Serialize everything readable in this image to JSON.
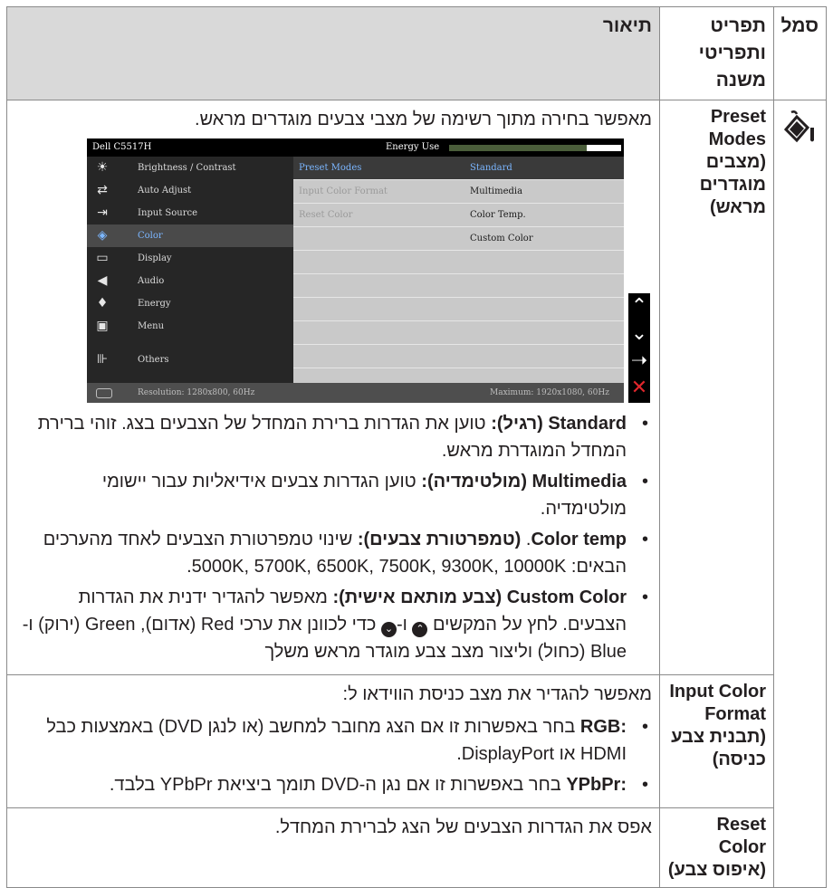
{
  "header": {
    "symbol": "סמל",
    "submenu": "תפריט ותפריטי משנה",
    "description": "תיאור"
  },
  "rows": [
    {
      "icon": "color-icon",
      "name": "Preset Modes (מצבים מוגדרים מראש)",
      "intro": "מאפשר בחירה מתוך רשימה של מצבי צבעים מוגדרים מראש."
    },
    {
      "name": "Input Color Format (תבנית צבע כניסה)",
      "intro": "מאפשר להגדיר את מצב כניסת הווידאו ל:"
    },
    {
      "name": "Reset Color (איפוס צבע)",
      "intro": "אפס את הגדרות הצבעים של הצג לברירת המחדל."
    }
  ],
  "osd": {
    "model": "Dell C5517H",
    "energy_label": "Energy Use",
    "energy_level": 0.8,
    "menu": [
      {
        "icon": "brightness-icon",
        "label": "Brightness / Contrast"
      },
      {
        "icon": "auto-adjust-icon",
        "label": "Auto Adjust"
      },
      {
        "icon": "input-source-icon",
        "label": "Input Source"
      },
      {
        "icon": "color-icon",
        "label": "Color"
      },
      {
        "icon": "display-icon",
        "label": "Display"
      },
      {
        "icon": "audio-icon",
        "label": "Audio"
      },
      {
        "icon": "energy-icon",
        "label": "Energy"
      },
      {
        "icon": "menu-icon",
        "label": "Menu"
      },
      {
        "icon": "others-icon",
        "label": "Others"
      }
    ],
    "submenu": [
      "Preset Modes",
      "Input Color Format",
      "Reset Color"
    ],
    "options": [
      "Standard",
      "Multimedia",
      "Color Temp.",
      "Custom Color"
    ],
    "resolution": "Resolution: 1280x800, 60Hz",
    "maximum": "Maximum: 1920x1080, 60Hz"
  },
  "preset_bullets": {
    "standard_en": "Standard",
    "standard_he": "(רגיל):",
    "standard_text": "טוען את הגדרות ברירת המחדל של הצבעים בצג. זוהי ברירת המחדל המוגדרת מראש.",
    "multimedia_en": "Multimedia",
    "multimedia_he": "(מולטימדיה):",
    "multimedia_text": "טוען הגדרות צבעים אידיאליות עבור יישומי מולטימדיה.",
    "colortemp_en": "Color temp",
    "colortemp_he": "(טמפרטורת צבעים):",
    "colortemp_text": "שינוי טמפרטורת הצבעים לאחד מהערכים הבאים: 5000K, 5700K, 6500K, 7500K, 9300K, 10000K.",
    "custom_en": "Custom Color",
    "custom_he": "(צבע מותאם אישית):",
    "custom_text1": "מאפשר להגדיר ידנית את הגדרות הצבעים. לחץ על המקשים",
    "custom_and": "ו-",
    "custom_text2": "כדי לכוונן את ערכי Red (אדום), Green (ירוק) ו-Blue (כחול) וליצור מצב צבע מוגדר מראש משלך"
  },
  "input_bullets": {
    "rgb_en": "RGB:",
    "rgb_text": "בחר באפשרות זו אם הצג מחובר למחשב (או לנגן DVD) באמצעות כבל HDMI או DisplayPort.",
    "ypbpr_en": "YPbPr:",
    "ypbpr_text": "בחר באפשרות זו אם נגן ה-DVD תומך ביציאת YPbPr בלבד."
  }
}
